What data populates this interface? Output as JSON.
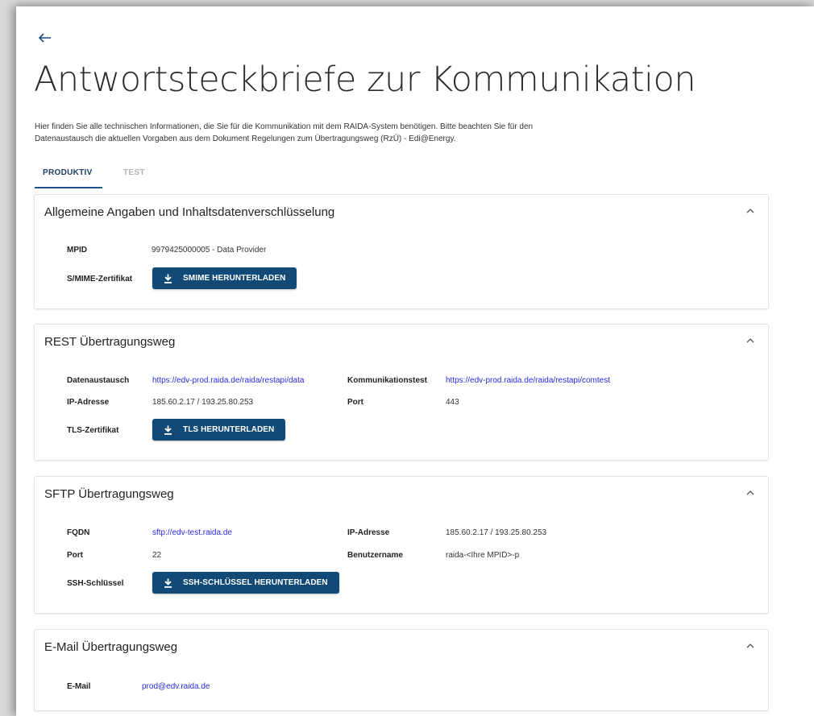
{
  "header": {
    "title": "Antwortsteckbriefe zur Kommunikation",
    "intro_line1": "Hier finden Sie alle technischen Informationen, die Sie für die Kommunikation mit dem RAIDA-System benötigen. Bitte beachten Sie für den",
    "intro_line2": "Datenaustausch die aktuellen Vorgaben aus dem Dokument Regelungen zum Übertragungsweg (RzÜ) - Edi@Energy."
  },
  "tabs": [
    {
      "label": "PRODUKTIV",
      "active": true
    },
    {
      "label": "TEST",
      "active": false
    }
  ],
  "panels": {
    "general": {
      "title": "Allgemeine Angaben und Inhaltsdatenverschlüsselung",
      "mpid_label": "MPID",
      "mpid_value": "9979425000005 - Data Provider",
      "smime_label": "S/MIME-Zertifikat",
      "smime_button": "SMIME HERUNTERLADEN"
    },
    "rest": {
      "title": "REST Übertragungsweg",
      "exchange_label": "Datenaustausch",
      "exchange_value": "https://edv-prod.raida.de/raida/restapi/data",
      "comtest_label": "Kommunikationstest",
      "comtest_value": "https://edv-prod.raida.de/raida/restapi/comtest",
      "ip_label": "IP-Adresse",
      "ip_value": "185.60.2.17 / 193.25.80.253",
      "port_label": "Port",
      "port_value": "443",
      "tls_label": "TLS-Zertifikat",
      "tls_button": "TLS HERUNTERLADEN"
    },
    "sftp": {
      "title": "SFTP Übertragungsweg",
      "fqdn_label": "FQDN",
      "fqdn_value": "sftp://edv-test.raida.de",
      "ip_label": "IP-Adresse",
      "ip_value": "185.60.2.17 / 193.25.80.253",
      "port_label": "Port",
      "port_value": "22",
      "user_label": "Benutzername",
      "user_value": "raida-<Ihre MPID>-p",
      "ssh_label": "SSH-Schlüssel",
      "ssh_button": "SSH-SCHLÜSSEL HERUNTERLADEN"
    },
    "email": {
      "title": "E-Mail Übertragungsweg",
      "email_label": "E-Mail",
      "email_value": "prod@edv.raida.de"
    }
  },
  "icons": {
    "back": "arrow-left-icon",
    "collapse": "chevron-up-icon",
    "download": "download-icon"
  },
  "colors": {
    "primary": "#124a77",
    "tab_active": "#1e3f63",
    "link": "#2a2ae0",
    "tab_inactive": "#b3b3b3"
  }
}
